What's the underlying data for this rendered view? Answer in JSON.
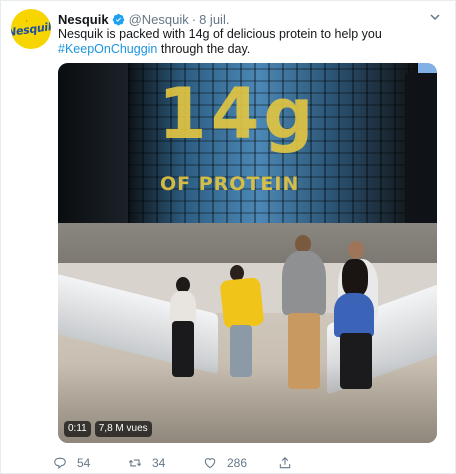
{
  "tweet": {
    "avatar_icon": "nesquik-logo-icon",
    "avatar_text": "Nesquik",
    "name": "Nesquik",
    "verified_icon": "verified-badge-icon",
    "handle": "@Nesquik",
    "separator": "·",
    "date": "8 juil.",
    "text": "Nesquik is packed with 14g of delicious protein to help you",
    "hashtag": "#KeepOnChuggin",
    "text_after": " through the day.",
    "media": {
      "overlay_big": "14g",
      "overlay_sub": "OF PROTEIN",
      "duration": "0:11",
      "views": "7,8 M vues"
    },
    "actions": {
      "reply_icon": "reply-icon",
      "reply_count": "54",
      "retweet_icon": "retweet-icon",
      "retweet_count": "34",
      "like_icon": "heart-icon",
      "like_count": "286",
      "share_icon": "share-icon"
    },
    "colors": {
      "link": "#1b95e0",
      "muted": "#657786",
      "verified": "#1da1f2",
      "brand_yellow": "#f7d500"
    }
  }
}
